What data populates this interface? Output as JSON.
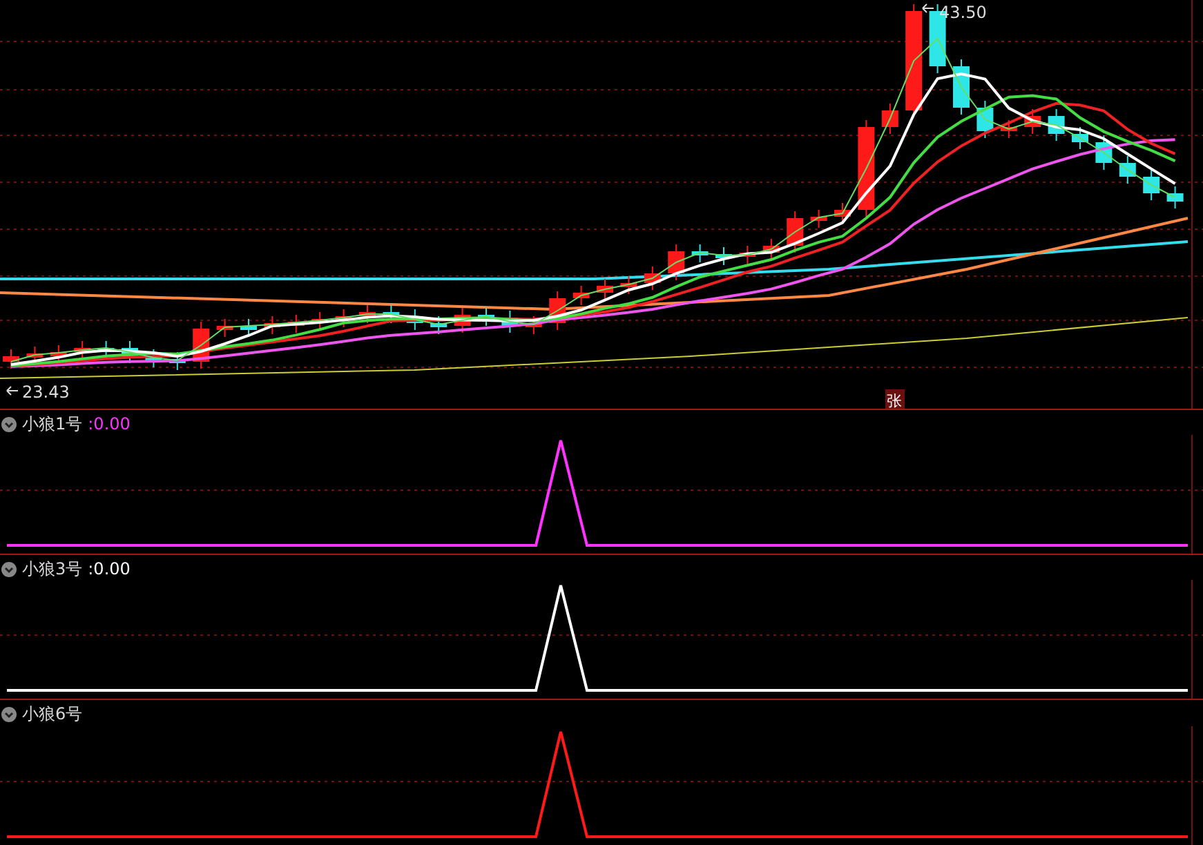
{
  "main_chart": {
    "high_label": "43.50",
    "low_label": "23.43",
    "limit_badge": "张"
  },
  "indicators": [
    {
      "name": "小狼1号",
      "value": ":0.00",
      "color": "#ff33ff"
    },
    {
      "name": "小狼3号",
      "value": ":0.00",
      "color": "#ffffff"
    },
    {
      "name": "小狼6号",
      "color": "#ff1a1a"
    }
  ]
}
